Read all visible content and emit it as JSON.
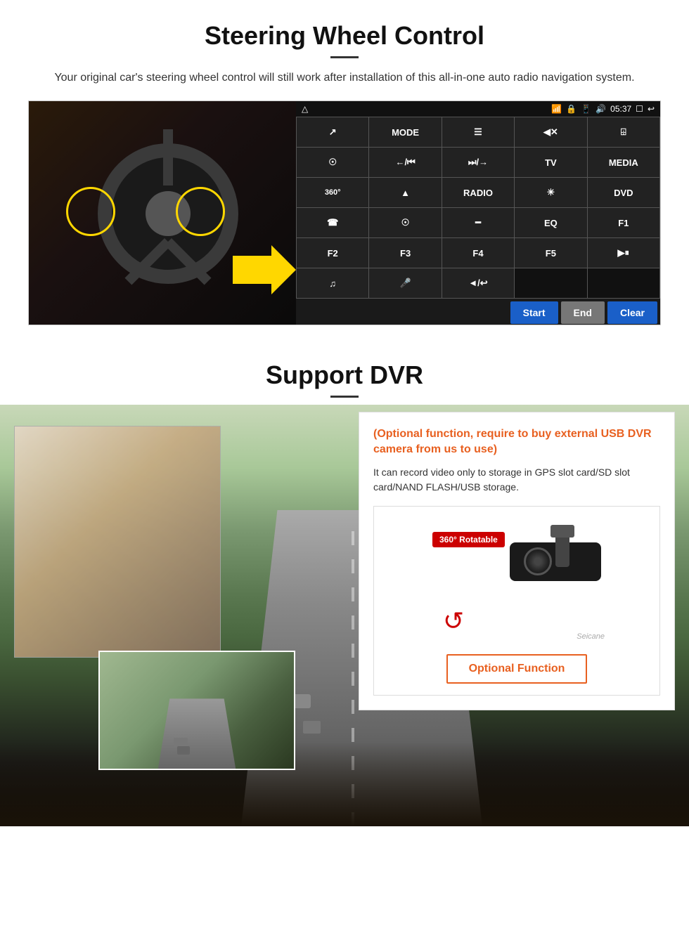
{
  "section1": {
    "title": "Steering Wheel Control",
    "description": "Your original car's steering wheel control will still work after installation of this all-in-one auto radio navigation system.",
    "statusbar": {
      "time": "05:37",
      "icons": [
        "wifi",
        "lock",
        "grid",
        "volume",
        "window",
        "back"
      ]
    },
    "ui_buttons": [
      {
        "label": "↗",
        "row": 1,
        "col": 1
      },
      {
        "label": "MODE",
        "row": 1,
        "col": 2
      },
      {
        "label": "☰",
        "row": 1,
        "col": 3
      },
      {
        "label": "◀×",
        "row": 1,
        "col": 4
      },
      {
        "label": "⊞",
        "row": 1,
        "col": 5
      },
      {
        "label": "⊙",
        "row": 2,
        "col": 1
      },
      {
        "label": "←/⏮",
        "row": 2,
        "col": 2
      },
      {
        "label": "⏭/→",
        "row": 2,
        "col": 3
      },
      {
        "label": "TV",
        "row": 2,
        "col": 4
      },
      {
        "label": "MEDIA",
        "row": 2,
        "col": 5
      },
      {
        "label": "360°",
        "row": 3,
        "col": 1
      },
      {
        "label": "▲",
        "row": 3,
        "col": 2
      },
      {
        "label": "RADIO",
        "row": 3,
        "col": 3
      },
      {
        "label": "☼",
        "row": 3,
        "col": 4
      },
      {
        "label": "DVD",
        "row": 3,
        "col": 5
      },
      {
        "label": "☎",
        "row": 4,
        "col": 1
      },
      {
        "label": "@",
        "row": 4,
        "col": 2
      },
      {
        "label": "▭",
        "row": 4,
        "col": 3
      },
      {
        "label": "EQ",
        "row": 4,
        "col": 4
      },
      {
        "label": "F1",
        "row": 4,
        "col": 5
      },
      {
        "label": "F2",
        "row": 5,
        "col": 1
      },
      {
        "label": "F3",
        "row": 5,
        "col": 2
      },
      {
        "label": "F4",
        "row": 5,
        "col": 3
      },
      {
        "label": "F5",
        "row": 5,
        "col": 4
      },
      {
        "label": "▶⏸",
        "row": 5,
        "col": 5
      },
      {
        "label": "♫",
        "row": 6,
        "col": 1
      },
      {
        "label": "🎤",
        "row": 6,
        "col": 2
      },
      {
        "label": "◀/↩",
        "row": 6,
        "col": 3
      }
    ],
    "bottom_buttons": {
      "start": "Start",
      "end": "End",
      "clear": "Clear"
    }
  },
  "section2": {
    "title": "Support DVR",
    "info_card": {
      "orange_text": "(Optional function, require to buy external USB DVR camera from us to use)",
      "description": "It can record video only to storage in GPS slot card/SD slot card/NAND FLASH/USB storage.",
      "camera_badge": "360° Rotatable",
      "watermark": "Seicane"
    },
    "optional_button": "Optional Function"
  }
}
